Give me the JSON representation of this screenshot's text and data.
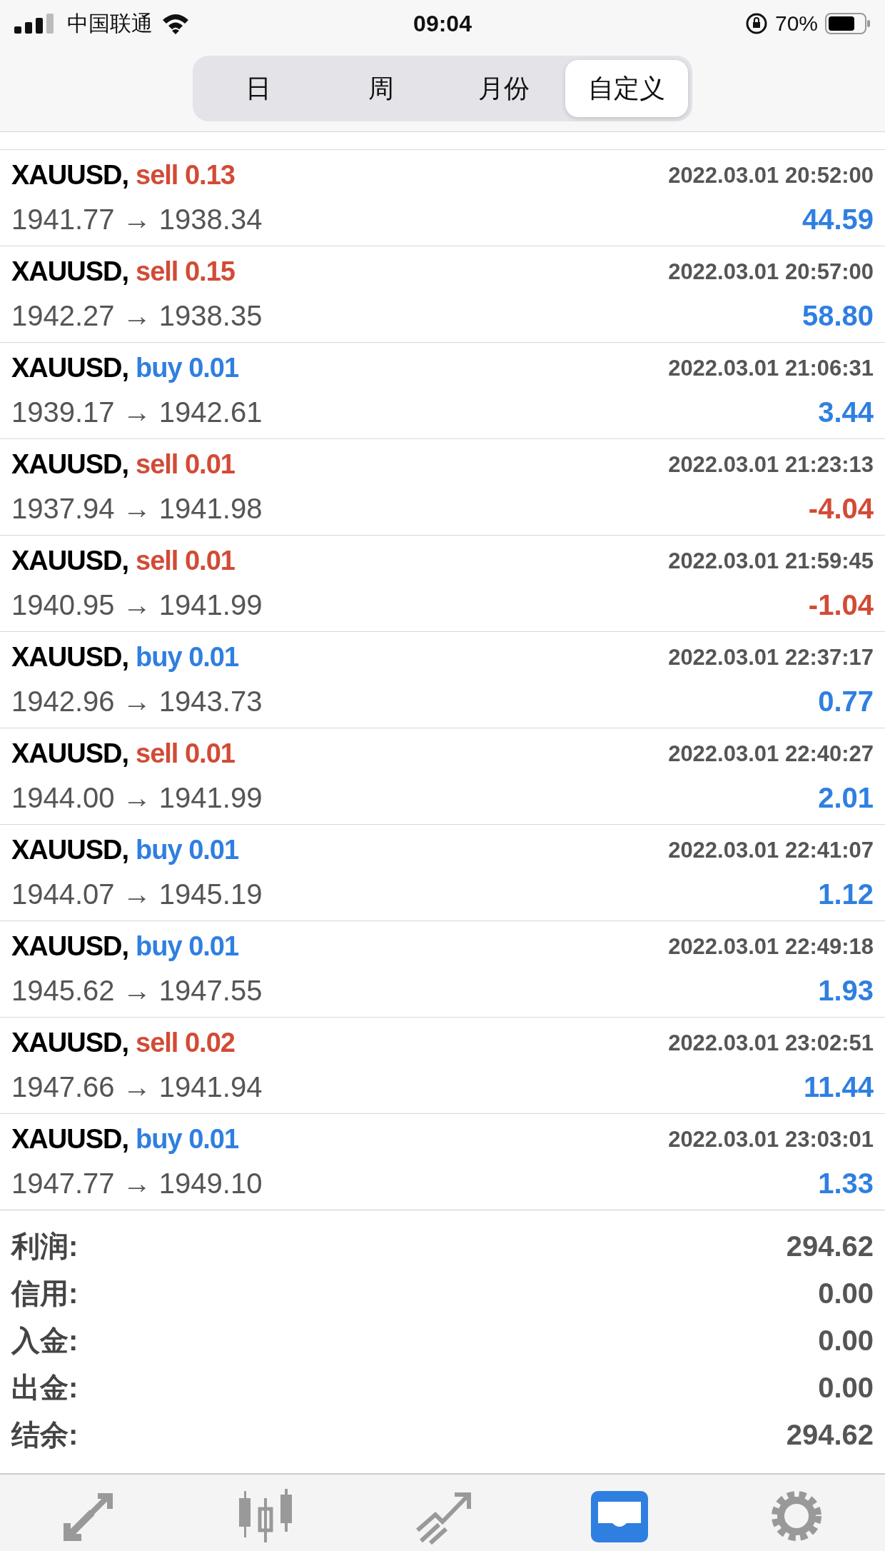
{
  "status_bar": {
    "carrier": "中国联通",
    "time": "09:04",
    "battery": "70%"
  },
  "period_tabs": [
    {
      "label": "日",
      "selected": false
    },
    {
      "label": "周",
      "selected": false
    },
    {
      "label": "月份",
      "selected": false
    },
    {
      "label": "自定义",
      "selected": true
    }
  ],
  "deals": [
    {
      "symbol": "XAUUSD,",
      "order": {
        "text": "sell 0.13",
        "color": "#d24b36"
      },
      "time": "2022.03.01 20:52:00",
      "prices": "1941.77 → 1938.34",
      "profit": {
        "text": "44.59",
        "color": "#2f7fe0"
      }
    },
    {
      "symbol": "XAUUSD,",
      "order": {
        "text": "sell 0.15",
        "color": "#d24b36"
      },
      "time": "2022.03.01 20:57:00",
      "prices": "1942.27 → 1938.35",
      "profit": {
        "text": "58.80",
        "color": "#2f7fe0"
      }
    },
    {
      "symbol": "XAUUSD,",
      "order": {
        "text": "buy 0.01",
        "color": "#2f7fe0"
      },
      "time": "2022.03.01 21:06:31",
      "prices": "1939.17 → 1942.61",
      "profit": {
        "text": "3.44",
        "color": "#2f7fe0"
      }
    },
    {
      "symbol": "XAUUSD,",
      "order": {
        "text": "sell 0.01",
        "color": "#d24b36"
      },
      "time": "2022.03.01 21:23:13",
      "prices": "1937.94 → 1941.98",
      "profit": {
        "text": "-4.04",
        "color": "#d24b36"
      }
    },
    {
      "symbol": "XAUUSD,",
      "order": {
        "text": "sell 0.01",
        "color": "#d24b36"
      },
      "time": "2022.03.01 21:59:45",
      "prices": "1940.95 → 1941.99",
      "profit": {
        "text": "-1.04",
        "color": "#d24b36"
      }
    },
    {
      "symbol": "XAUUSD,",
      "order": {
        "text": "buy 0.01",
        "color": "#2f7fe0"
      },
      "time": "2022.03.01 22:37:17",
      "prices": "1942.96 → 1943.73",
      "profit": {
        "text": "0.77",
        "color": "#2f7fe0"
      }
    },
    {
      "symbol": "XAUUSD,",
      "order": {
        "text": "sell 0.01",
        "color": "#d24b36"
      },
      "time": "2022.03.01 22:40:27",
      "prices": "1944.00 → 1941.99",
      "profit": {
        "text": "2.01",
        "color": "#2f7fe0"
      }
    },
    {
      "symbol": "XAUUSD,",
      "order": {
        "text": "buy 0.01",
        "color": "#2f7fe0"
      },
      "time": "2022.03.01 22:41:07",
      "prices": "1944.07 → 1945.19",
      "profit": {
        "text": "1.12",
        "color": "#2f7fe0"
      }
    },
    {
      "symbol": "XAUUSD,",
      "order": {
        "text": "buy 0.01",
        "color": "#2f7fe0"
      },
      "time": "2022.03.01 22:49:18",
      "prices": "1945.62 → 1947.55",
      "profit": {
        "text": "1.93",
        "color": "#2f7fe0"
      }
    },
    {
      "symbol": "XAUUSD,",
      "order": {
        "text": "sell 0.02",
        "color": "#d24b36"
      },
      "time": "2022.03.01 23:02:51",
      "prices": "1947.66 → 1941.94",
      "profit": {
        "text": "11.44",
        "color": "#2f7fe0"
      }
    },
    {
      "symbol": "XAUUSD,",
      "order": {
        "text": "buy 0.01",
        "color": "#2f7fe0"
      },
      "time": "2022.03.01 23:03:01",
      "prices": "1947.77 → 1949.10",
      "profit": {
        "text": "1.33",
        "color": "#2f7fe0"
      }
    }
  ],
  "summary": [
    {
      "label": "利润:",
      "value": "294.62"
    },
    {
      "label": "信用:",
      "value": "0.00"
    },
    {
      "label": "入金:",
      "value": "0.00"
    },
    {
      "label": "出金:",
      "value": "0.00"
    },
    {
      "label": "结余:",
      "value": "294.62"
    }
  ],
  "tab_bar": [
    {
      "kind": "quotes",
      "selected": false
    },
    {
      "kind": "chart",
      "selected": false
    },
    {
      "kind": "trade",
      "selected": false
    },
    {
      "kind": "history",
      "selected": true
    },
    {
      "kind": "settings",
      "selected": false
    }
  ]
}
